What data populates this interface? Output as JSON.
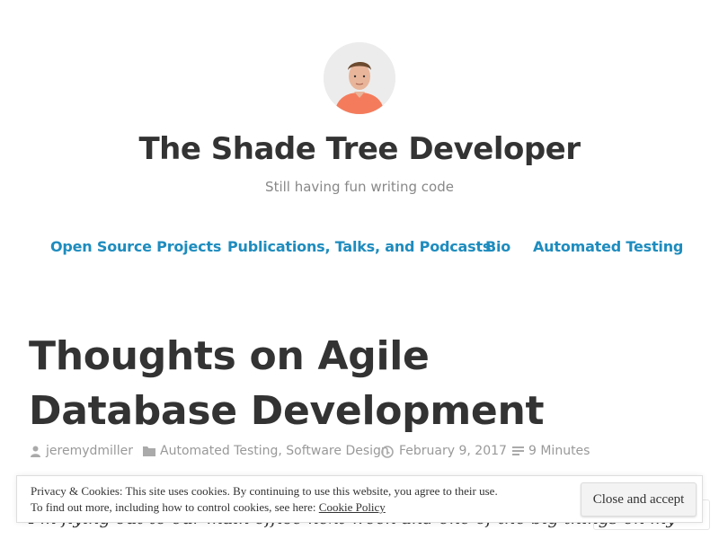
{
  "site": {
    "title": "The Shade Tree Developer",
    "tagline": "Still having fun writing code"
  },
  "nav": {
    "items": [
      {
        "label": "Open Source Projects"
      },
      {
        "label": "Publications, Talks, and Podcasts"
      },
      {
        "label": "Bio"
      },
      {
        "label": "Automated Testing"
      }
    ]
  },
  "post": {
    "title_line1": "Thoughts on Agile",
    "title_line2": "Database Development",
    "author": "jeremydmiller",
    "categories": "Automated Testing, Software Design",
    "date": "February 9, 2017",
    "reading_time": "9 Minutes",
    "body_start": "I'm flying out to our main office next week and one of the big things on my"
  },
  "cookie": {
    "line1": "Privacy & Cookies: This site uses cookies. By continuing to use this website, you agree to their use.",
    "line2_prefix": "To find out more, including how to control cookies, see here: ",
    "link": "Cookie Policy",
    "accept": "Close and accept"
  },
  "icons": [
    "user-icon",
    "folder-icon",
    "clock-icon",
    "text-lines-icon"
  ],
  "colors": {
    "link": "#1e8cbe",
    "title": "#333333",
    "muted": "#999999",
    "avatar_shirt": "#f47c5c"
  }
}
